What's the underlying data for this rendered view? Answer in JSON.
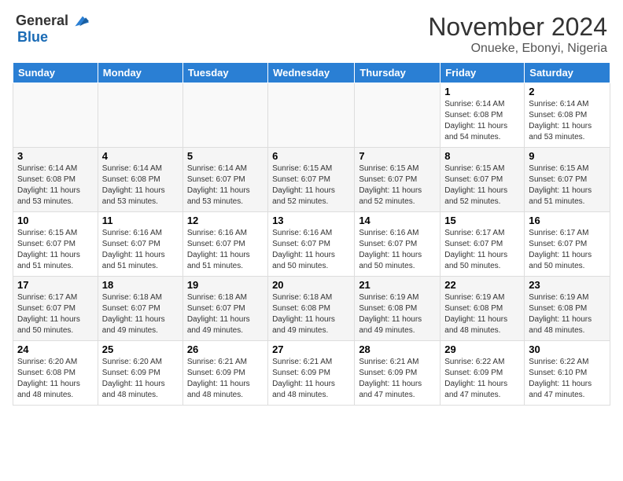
{
  "header": {
    "logo_general": "General",
    "logo_blue": "Blue",
    "month_title": "November 2024",
    "location": "Onueke, Ebonyi, Nigeria"
  },
  "days_of_week": [
    "Sunday",
    "Monday",
    "Tuesday",
    "Wednesday",
    "Thursday",
    "Friday",
    "Saturday"
  ],
  "weeks": [
    [
      {
        "day": "",
        "info": ""
      },
      {
        "day": "",
        "info": ""
      },
      {
        "day": "",
        "info": ""
      },
      {
        "day": "",
        "info": ""
      },
      {
        "day": "",
        "info": ""
      },
      {
        "day": "1",
        "info": "Sunrise: 6:14 AM\nSunset: 6:08 PM\nDaylight: 11 hours and 54 minutes."
      },
      {
        "day": "2",
        "info": "Sunrise: 6:14 AM\nSunset: 6:08 PM\nDaylight: 11 hours and 53 minutes."
      }
    ],
    [
      {
        "day": "3",
        "info": "Sunrise: 6:14 AM\nSunset: 6:08 PM\nDaylight: 11 hours and 53 minutes."
      },
      {
        "day": "4",
        "info": "Sunrise: 6:14 AM\nSunset: 6:08 PM\nDaylight: 11 hours and 53 minutes."
      },
      {
        "day": "5",
        "info": "Sunrise: 6:14 AM\nSunset: 6:07 PM\nDaylight: 11 hours and 53 minutes."
      },
      {
        "day": "6",
        "info": "Sunrise: 6:15 AM\nSunset: 6:07 PM\nDaylight: 11 hours and 52 minutes."
      },
      {
        "day": "7",
        "info": "Sunrise: 6:15 AM\nSunset: 6:07 PM\nDaylight: 11 hours and 52 minutes."
      },
      {
        "day": "8",
        "info": "Sunrise: 6:15 AM\nSunset: 6:07 PM\nDaylight: 11 hours and 52 minutes."
      },
      {
        "day": "9",
        "info": "Sunrise: 6:15 AM\nSunset: 6:07 PM\nDaylight: 11 hours and 51 minutes."
      }
    ],
    [
      {
        "day": "10",
        "info": "Sunrise: 6:15 AM\nSunset: 6:07 PM\nDaylight: 11 hours and 51 minutes."
      },
      {
        "day": "11",
        "info": "Sunrise: 6:16 AM\nSunset: 6:07 PM\nDaylight: 11 hours and 51 minutes."
      },
      {
        "day": "12",
        "info": "Sunrise: 6:16 AM\nSunset: 6:07 PM\nDaylight: 11 hours and 51 minutes."
      },
      {
        "day": "13",
        "info": "Sunrise: 6:16 AM\nSunset: 6:07 PM\nDaylight: 11 hours and 50 minutes."
      },
      {
        "day": "14",
        "info": "Sunrise: 6:16 AM\nSunset: 6:07 PM\nDaylight: 11 hours and 50 minutes."
      },
      {
        "day": "15",
        "info": "Sunrise: 6:17 AM\nSunset: 6:07 PM\nDaylight: 11 hours and 50 minutes."
      },
      {
        "day": "16",
        "info": "Sunrise: 6:17 AM\nSunset: 6:07 PM\nDaylight: 11 hours and 50 minutes."
      }
    ],
    [
      {
        "day": "17",
        "info": "Sunrise: 6:17 AM\nSunset: 6:07 PM\nDaylight: 11 hours and 50 minutes."
      },
      {
        "day": "18",
        "info": "Sunrise: 6:18 AM\nSunset: 6:07 PM\nDaylight: 11 hours and 49 minutes."
      },
      {
        "day": "19",
        "info": "Sunrise: 6:18 AM\nSunset: 6:07 PM\nDaylight: 11 hours and 49 minutes."
      },
      {
        "day": "20",
        "info": "Sunrise: 6:18 AM\nSunset: 6:08 PM\nDaylight: 11 hours and 49 minutes."
      },
      {
        "day": "21",
        "info": "Sunrise: 6:19 AM\nSunset: 6:08 PM\nDaylight: 11 hours and 49 minutes."
      },
      {
        "day": "22",
        "info": "Sunrise: 6:19 AM\nSunset: 6:08 PM\nDaylight: 11 hours and 48 minutes."
      },
      {
        "day": "23",
        "info": "Sunrise: 6:19 AM\nSunset: 6:08 PM\nDaylight: 11 hours and 48 minutes."
      }
    ],
    [
      {
        "day": "24",
        "info": "Sunrise: 6:20 AM\nSunset: 6:08 PM\nDaylight: 11 hours and 48 minutes."
      },
      {
        "day": "25",
        "info": "Sunrise: 6:20 AM\nSunset: 6:09 PM\nDaylight: 11 hours and 48 minutes."
      },
      {
        "day": "26",
        "info": "Sunrise: 6:21 AM\nSunset: 6:09 PM\nDaylight: 11 hours and 48 minutes."
      },
      {
        "day": "27",
        "info": "Sunrise: 6:21 AM\nSunset: 6:09 PM\nDaylight: 11 hours and 48 minutes."
      },
      {
        "day": "28",
        "info": "Sunrise: 6:21 AM\nSunset: 6:09 PM\nDaylight: 11 hours and 47 minutes."
      },
      {
        "day": "29",
        "info": "Sunrise: 6:22 AM\nSunset: 6:09 PM\nDaylight: 11 hours and 47 minutes."
      },
      {
        "day": "30",
        "info": "Sunrise: 6:22 AM\nSunset: 6:10 PM\nDaylight: 11 hours and 47 minutes."
      }
    ]
  ]
}
